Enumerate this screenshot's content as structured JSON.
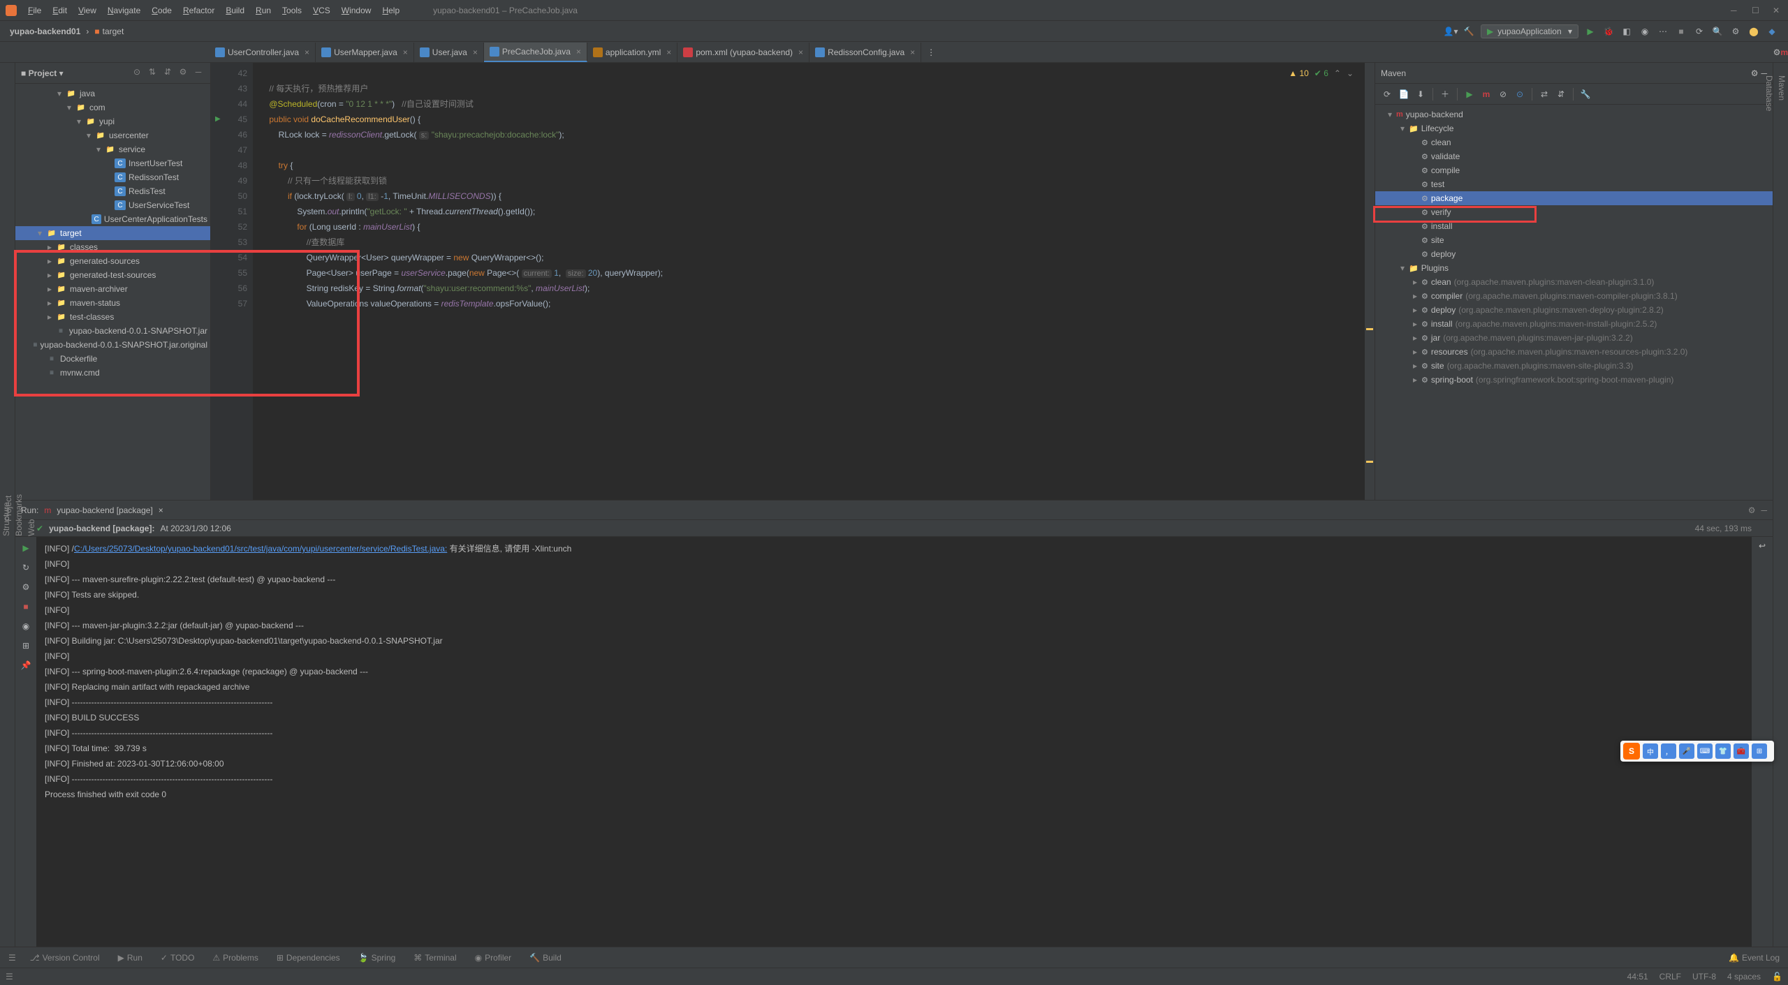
{
  "menubar": {
    "items": [
      "File",
      "Edit",
      "View",
      "Navigate",
      "Code",
      "Refactor",
      "Build",
      "Run",
      "Tools",
      "VCS",
      "Window",
      "Help"
    ],
    "title": "yupao-backend01 – PreCacheJob.java"
  },
  "breadcrumb": {
    "project": "yupao-backend01",
    "path": "target"
  },
  "runConfig": {
    "name": "yupaoApplication"
  },
  "tabs": [
    {
      "label": "UserController.java",
      "type": "java",
      "active": false
    },
    {
      "label": "UserMapper.java",
      "type": "java",
      "active": false
    },
    {
      "label": "User.java",
      "type": "java",
      "active": false
    },
    {
      "label": "PreCacheJob.java",
      "type": "java",
      "active": true
    },
    {
      "label": "application.yml",
      "type": "yml",
      "active": false
    },
    {
      "label": "pom.xml (yupao-backend)",
      "type": "maven",
      "active": false
    },
    {
      "label": "RedissonConfig.java",
      "type": "java",
      "active": false
    }
  ],
  "projectTree": [
    {
      "indent": 4,
      "arrow": "▾",
      "icon": "folder-blue",
      "label": "java"
    },
    {
      "indent": 5,
      "arrow": "▾",
      "icon": "folder",
      "label": "com"
    },
    {
      "indent": 6,
      "arrow": "▾",
      "icon": "folder",
      "label": "yupi"
    },
    {
      "indent": 7,
      "arrow": "▾",
      "icon": "folder",
      "label": "usercenter"
    },
    {
      "indent": 8,
      "arrow": "▾",
      "icon": "folder",
      "label": "service"
    },
    {
      "indent": 9,
      "arrow": "",
      "icon": "class",
      "label": "InsertUserTest"
    },
    {
      "indent": 9,
      "arrow": "",
      "icon": "class",
      "label": "RedissonTest"
    },
    {
      "indent": 9,
      "arrow": "",
      "icon": "class",
      "label": "RedisTest"
    },
    {
      "indent": 9,
      "arrow": "",
      "icon": "class",
      "label": "UserServiceTest"
    },
    {
      "indent": 8,
      "arrow": "",
      "icon": "class",
      "label": "UserCenterApplicationTests"
    },
    {
      "indent": 2,
      "arrow": "▾",
      "icon": "folder-orange",
      "label": "target",
      "highlight": true,
      "selected": true
    },
    {
      "indent": 3,
      "arrow": "▸",
      "icon": "folder-orange",
      "label": "classes",
      "highlight": true
    },
    {
      "indent": 3,
      "arrow": "▸",
      "icon": "folder-orange",
      "label": "generated-sources",
      "highlight": true
    },
    {
      "indent": 3,
      "arrow": "▸",
      "icon": "folder-orange",
      "label": "generated-test-sources",
      "highlight": true
    },
    {
      "indent": 3,
      "arrow": "▸",
      "icon": "folder-orange",
      "label": "maven-archiver",
      "highlight": true
    },
    {
      "indent": 3,
      "arrow": "▸",
      "icon": "folder-orange",
      "label": "maven-status",
      "highlight": true
    },
    {
      "indent": 3,
      "arrow": "▸",
      "icon": "folder-orange",
      "label": "test-classes",
      "highlight": true
    },
    {
      "indent": 3,
      "arrow": "",
      "icon": "file",
      "label": "yupao-backend-0.0.1-SNAPSHOT.jar",
      "highlight": true
    },
    {
      "indent": 3,
      "arrow": "",
      "icon": "file",
      "label": "yupao-backend-0.0.1-SNAPSHOT.jar.original",
      "highlight": true
    },
    {
      "indent": 2,
      "arrow": "",
      "icon": "file",
      "label": "Dockerfile"
    },
    {
      "indent": 2,
      "arrow": "",
      "icon": "file",
      "label": "mvnw.cmd"
    }
  ],
  "editor": {
    "warnings": "10",
    "oks": "6",
    "gutter_start": 42,
    "lines": [
      {
        "n": 42,
        "html": ""
      },
      {
        "n": 43,
        "html": "    <span class='com'>// 每天执行，预热推荐用户</span>"
      },
      {
        "n": 44,
        "html": "    <span class='anno'>@Scheduled</span>(cron = <span class='str'>\"0 12 1 * * *\"</span>)   <span class='com'>//自己设置时间测试</span>"
      },
      {
        "n": 45,
        "html": "    <span class='kw'>public void</span> <span class='method'>doCacheRecommendUser</span>() {",
        "run": true
      },
      {
        "n": 46,
        "html": "        RLock lock = <span class='field'>redissonClient</span>.getLock( <span class='hint'>s:</span> <span class='str'>\"shayu:precachejob:docache:lock\"</span>);"
      },
      {
        "n": 47,
        "html": ""
      },
      {
        "n": 48,
        "html": "        <span class='kw'>try</span> {"
      },
      {
        "n": 49,
        "html": "            <span class='com'>// 只有一个线程能获取到锁</span>"
      },
      {
        "n": 50,
        "html": "            <span class='kw'>if</span> (lock.tryLock( <span class='hint'>l:</span> <span class='num'>0</span>, <span class='hint'>l1:</span> -<span class='num'>1</span>, TimeUnit.<span class='field static'>MILLISECONDS</span>)) {"
      },
      {
        "n": 51,
        "html": "                System.<span class='field static'>out</span>.println(<span class='str'>\"getLock: \"</span> + Thread.<span class='static'>currentThread</span>().getId());"
      },
      {
        "n": 52,
        "html": "                <span class='kw'>for</span> (Long userId : <span class='field'>mainUserList</span>) {"
      },
      {
        "n": 53,
        "html": "                    <span class='com'>//查数据库</span>"
      },
      {
        "n": 54,
        "html": "                    QueryWrapper&lt;User&gt; queryWrapper = <span class='kw'>new</span> QueryWrapper&lt;&gt;();"
      },
      {
        "n": 55,
        "html": "                    Page&lt;User&gt; userPage = <span class='field'>userService</span>.page(<span class='kw'>new</span> Page&lt;&gt;( <span class='hint'>current:</span> <span class='num'>1</span>,  <span class='hint'>size:</span> <span class='num'>20</span>), queryWrapper);"
      },
      {
        "n": 56,
        "html": "                    String redisKey = String.<span class='static'>format</span>(<span class='str'>\"shayu:user:recommend:%s\"</span>, <span class='field'>mainUserList</span>);"
      },
      {
        "n": 57,
        "html": "                    <span class='type'>ValueOperations</span> valueOperations = <span class='field'>redisTemplate</span>.opsForValue();"
      }
    ]
  },
  "maven": {
    "title": "Maven",
    "tree": [
      {
        "indent": 0,
        "arrow": "▾",
        "icon": "m",
        "label": "yupao-backend"
      },
      {
        "indent": 1,
        "arrow": "▾",
        "icon": "folder",
        "label": "Lifecycle"
      },
      {
        "indent": 2,
        "arrow": "",
        "icon": "gear",
        "label": "clean"
      },
      {
        "indent": 2,
        "arrow": "",
        "icon": "gear",
        "label": "validate"
      },
      {
        "indent": 2,
        "arrow": "",
        "icon": "gear",
        "label": "compile"
      },
      {
        "indent": 2,
        "arrow": "",
        "icon": "gear",
        "label": "test"
      },
      {
        "indent": 2,
        "arrow": "",
        "icon": "gear",
        "label": "package",
        "selected": true
      },
      {
        "indent": 2,
        "arrow": "",
        "icon": "gear",
        "label": "verify"
      },
      {
        "indent": 2,
        "arrow": "",
        "icon": "gear",
        "label": "install"
      },
      {
        "indent": 2,
        "arrow": "",
        "icon": "gear",
        "label": "site"
      },
      {
        "indent": 2,
        "arrow": "",
        "icon": "gear",
        "label": "deploy"
      },
      {
        "indent": 1,
        "arrow": "▾",
        "icon": "folder",
        "label": "Plugins"
      },
      {
        "indent": 2,
        "arrow": "▸",
        "icon": "gear",
        "label": "clean",
        "desc": "(org.apache.maven.plugins:maven-clean-plugin:3.1.0)"
      },
      {
        "indent": 2,
        "arrow": "▸",
        "icon": "gear",
        "label": "compiler",
        "desc": "(org.apache.maven.plugins:maven-compiler-plugin:3.8.1)"
      },
      {
        "indent": 2,
        "arrow": "▸",
        "icon": "gear",
        "label": "deploy",
        "desc": "(org.apache.maven.plugins:maven-deploy-plugin:2.8.2)"
      },
      {
        "indent": 2,
        "arrow": "▸",
        "icon": "gear",
        "label": "install",
        "desc": "(org.apache.maven.plugins:maven-install-plugin:2.5.2)"
      },
      {
        "indent": 2,
        "arrow": "▸",
        "icon": "gear",
        "label": "jar",
        "desc": "(org.apache.maven.plugins:maven-jar-plugin:3.2.2)"
      },
      {
        "indent": 2,
        "arrow": "▸",
        "icon": "gear",
        "label": "resources",
        "desc": "(org.apache.maven.plugins:maven-resources-plugin:3.2.0)"
      },
      {
        "indent": 2,
        "arrow": "▸",
        "icon": "gear",
        "label": "site",
        "desc": "(org.apache.maven.plugins:maven-site-plugin:3.3)"
      },
      {
        "indent": 2,
        "arrow": "▸",
        "icon": "gear",
        "label": "spring-boot",
        "desc": "(org.springframework.boot:spring-boot-maven-plugin)"
      }
    ]
  },
  "run": {
    "title_prefix": "Run:",
    "config": "yupao-backend [package]",
    "status_prefix": "yupao-backend [package]:",
    "status_time": "At 2023/1/30 12:06",
    "timing": "44 sec, 193 ms",
    "console_lines": [
      "[INFO] /<span class='link'>C:/Users/25073/Desktop/yupao-backend01/src/test/java/com/yupi/usercenter/service/RedisTest.java:</span> 有关详细信息, 请使用 -Xlint:unch",
      "[INFO]",
      "[INFO] --- maven-surefire-plugin:2.22.2:test (default-test) @ yupao-backend ---",
      "[INFO] Tests are skipped.",
      "[INFO]",
      "[INFO] --- maven-jar-plugin:3.2.2:jar (default-jar) @ yupao-backend ---",
      "[INFO] Building jar: C:\\Users\\25073\\Desktop\\yupao-backend01\\target\\yupao-backend-0.0.1-SNAPSHOT.jar",
      "[INFO]",
      "[INFO] --- spring-boot-maven-plugin:2.6.4:repackage (repackage) @ yupao-backend ---",
      "[INFO] Replacing main artifact with repackaged archive",
      "[INFO] ------------------------------------------------------------------------",
      "[INFO] BUILD SUCCESS",
      "[INFO] ------------------------------------------------------------------------",
      "[INFO] Total time:  39.739 s",
      "[INFO] Finished at: 2023-01-30T12:06:00+08:00",
      "[INFO] ------------------------------------------------------------------------",
      "",
      "Process finished with exit code 0"
    ]
  },
  "bottombar": {
    "items": [
      "Version Control",
      "Run",
      "TODO",
      "Problems",
      "Dependencies",
      "Spring",
      "Terminal",
      "Profiler",
      "Build"
    ],
    "event_log": "Event Log"
  },
  "statusbar": {
    "pos": "44:51",
    "eol": "CRLF",
    "enc": "UTF-8",
    "indent": "4 spaces"
  },
  "leftRail": [
    "Project",
    "Bookmarks",
    "Structure",
    "Web"
  ],
  "rightRail": [
    "Maven",
    "Database"
  ],
  "projectHeader": {
    "title": "Project"
  },
  "ime": {
    "lang": "中"
  }
}
